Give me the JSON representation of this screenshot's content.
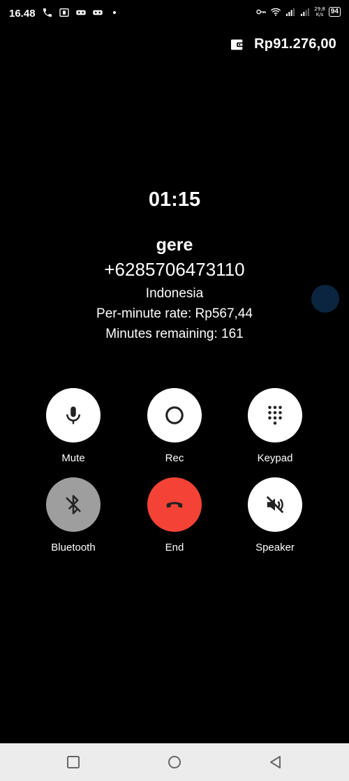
{
  "status_bar": {
    "time": "16.48",
    "network_speed_value": "29,8",
    "network_speed_unit": "K/s",
    "battery": "94"
  },
  "balance": {
    "amount": "Rp91.276,00"
  },
  "call": {
    "timer": "01:15",
    "contact_name": "gere",
    "phone_number": "+6285706473110",
    "country": "Indonesia",
    "rate": "Per-minute rate: Rp567,44",
    "minutes_remaining": "Minutes remaining: 161"
  },
  "controls": {
    "mute": "Mute",
    "rec": "Rec",
    "keypad": "Keypad",
    "bluetooth": "Bluetooth",
    "end": "End",
    "speaker": "Speaker"
  },
  "colors": {
    "background": "#000000",
    "end_call": "#f44336",
    "bluetooth_inactive": "#9e9e9e",
    "button": "#ffffff",
    "nav_bar": "#ececec"
  },
  "icons": {
    "mute": "microphone-icon",
    "rec": "record-icon",
    "keypad": "dialpad-icon",
    "bluetooth": "bluetooth-disabled-icon",
    "end": "hangup-icon",
    "speaker": "speaker-off-icon"
  }
}
